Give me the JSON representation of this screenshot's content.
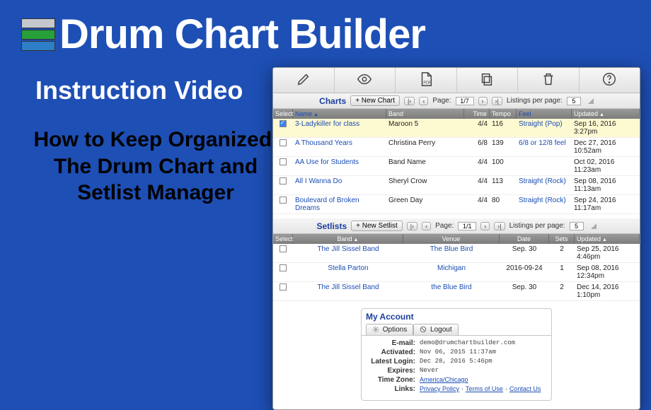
{
  "header": {
    "title": "Drum Chart Builder",
    "subtitle": "Instruction Video",
    "desc": "How to Keep Organized. The Drum Chart and Setlist Manager"
  },
  "charts": {
    "title": "Charts",
    "new_btn": "+ New Chart",
    "page_label": "Page:",
    "page_value": "1/7",
    "lpp_label": "Listings per page:",
    "lpp_value": "5",
    "headers": {
      "select": "Select",
      "name": "Name",
      "band": "Band",
      "time": "Time",
      "tempo": "Tempo",
      "feel": "Feel",
      "updated": "Updated"
    },
    "rows": [
      {
        "sel": true,
        "name": "3-Ladykiller for class",
        "band": "Maroon 5",
        "time": "4/4",
        "tempo": "116",
        "feel": "Straight (Pop)",
        "updated": "Sep 16, 2016 3:27pm"
      },
      {
        "sel": false,
        "name": "A Thousand Years",
        "band": "Christina Perry",
        "time": "6/8",
        "tempo": "139",
        "feel": "6/8 or 12/8 feel",
        "updated": "Dec 27, 2016 10:52am"
      },
      {
        "sel": false,
        "name": "AA Use for Students",
        "band": "Band Name",
        "time": "4/4",
        "tempo": "100",
        "feel": "",
        "updated": "Oct 02, 2016 11:23am"
      },
      {
        "sel": false,
        "name": "All I Wanna Do",
        "band": "Sheryl Crow",
        "time": "4/4",
        "tempo": "113",
        "feel": "Straight (Rock)",
        "updated": "Sep 08, 2016 11:13am"
      },
      {
        "sel": false,
        "name": "Boulevard of Broken Dreams",
        "band": "Green Day",
        "time": "4/4",
        "tempo": "80",
        "feel": "Straight (Rock)",
        "updated": "Sep 24, 2016 11:17am"
      }
    ]
  },
  "setlists": {
    "title": "Setlists",
    "new_btn": "+ New Setlist",
    "page_label": "Page:",
    "page_value": "1/1",
    "lpp_label": "Listings per page:",
    "lpp_value": "5",
    "headers": {
      "select": "Select",
      "band": "Band",
      "venue": "Venue",
      "date": "Date",
      "sets": "Sets",
      "updated": "Updated"
    },
    "rows": [
      {
        "band": "The Jill Sissel Band",
        "venue": "The Blue Bird",
        "date": "Sep. 30",
        "sets": "2",
        "updated": "Sep 25, 2016 4:46pm"
      },
      {
        "band": "Stella Parton",
        "venue": "Michigan",
        "date": "2016-09-24",
        "sets": "1",
        "updated": "Sep 08, 2016 12:34pm"
      },
      {
        "band": "The Jill Sissel Band",
        "venue": "the Blue Bird",
        "date": "Sep. 30",
        "sets": "2",
        "updated": "Dec 14, 2016 1:10pm"
      }
    ]
  },
  "account": {
    "title": "My Account",
    "tab_options": "Options",
    "tab_logout": "Logout",
    "rows": {
      "email_l": "E-mail:",
      "email_v": "demo@drumchartbuilder.com",
      "activated_l": "Activated:",
      "activated_v": "Nov 06, 2015 11:37am",
      "latest_l": "Latest Login:",
      "latest_v": "Dec 28, 2016 5:46pm",
      "expires_l": "Expires:",
      "expires_v": "Never",
      "tz_l": "Time Zone:",
      "tz_v": "America/Chicago",
      "links_l": "Links:",
      "link1": "Privacy Policy",
      "link2": "Terms of Use",
      "link3": "Contact Us"
    }
  }
}
